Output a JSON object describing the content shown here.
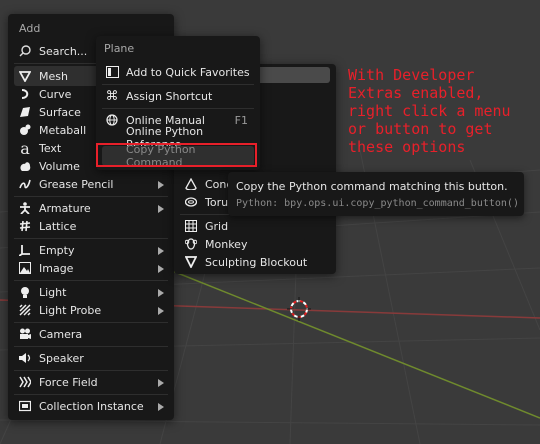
{
  "add_menu": {
    "title": "Add",
    "search": "Search...",
    "items": [
      {
        "label": "Mesh",
        "icon": "mesh-icon",
        "submenu": true
      },
      {
        "label": "Curve",
        "icon": "curve-icon",
        "submenu": true
      },
      {
        "label": "Surface",
        "icon": "surface-icon",
        "submenu": true
      },
      {
        "label": "Metaball",
        "icon": "metaball-icon",
        "submenu": true
      },
      {
        "label": "Text",
        "icon": "text-icon",
        "submenu": false
      },
      {
        "label": "Volume",
        "icon": "volume-icon",
        "submenu": true
      },
      {
        "label": "Grease Pencil",
        "icon": "grease-pencil-icon",
        "submenu": true
      },
      {
        "label": "Armature",
        "icon": "armature-icon",
        "submenu": true
      },
      {
        "label": "Lattice",
        "icon": "lattice-icon",
        "submenu": false
      },
      {
        "label": "Empty",
        "icon": "empty-icon",
        "submenu": true
      },
      {
        "label": "Image",
        "icon": "image-icon",
        "submenu": true
      },
      {
        "label": "Light",
        "icon": "light-icon",
        "submenu": true
      },
      {
        "label": "Light Probe",
        "icon": "light-probe-icon",
        "submenu": true
      },
      {
        "label": "Camera",
        "icon": "camera-icon",
        "submenu": false
      },
      {
        "label": "Speaker",
        "icon": "speaker-icon",
        "submenu": false
      },
      {
        "label": "Force Field",
        "icon": "force-field-icon",
        "submenu": true
      },
      {
        "label": "Collection Instance",
        "icon": "collection-instance-icon",
        "submenu": true
      }
    ]
  },
  "mesh_menu": {
    "items": [
      {
        "label": "Cone",
        "icon": "cone-icon"
      },
      {
        "label": "Torus",
        "icon": "torus-icon"
      },
      {
        "label": "Grid",
        "icon": "grid-icon"
      },
      {
        "label": "Monkey",
        "icon": "monkey-icon"
      },
      {
        "label": "Sculpting Blockout",
        "icon": "sculpting-blockout-icon"
      }
    ]
  },
  "context_menu": {
    "title": "Plane",
    "add_favorites": "Add to Quick Favorites",
    "assign_shortcut": "Assign Shortcut",
    "online_manual": "Online Manual",
    "online_manual_shortcut": "F1",
    "online_python_reference": "Online Python Reference",
    "copy_python_command": "Copy Python Command"
  },
  "tooltip": {
    "text": "Copy the Python command matching this button.",
    "python": "Python: bpy.ops.ui.copy_python_command_button()"
  },
  "annotation": {
    "text": "With Developer\nExtras enabled,\nright click a menu\nor button to get\nthese options"
  },
  "colors": {
    "menu_bg": "#181818",
    "highlight": "#2f2f2f",
    "annotation": "#e8202a",
    "disabled_text": "#888888"
  }
}
